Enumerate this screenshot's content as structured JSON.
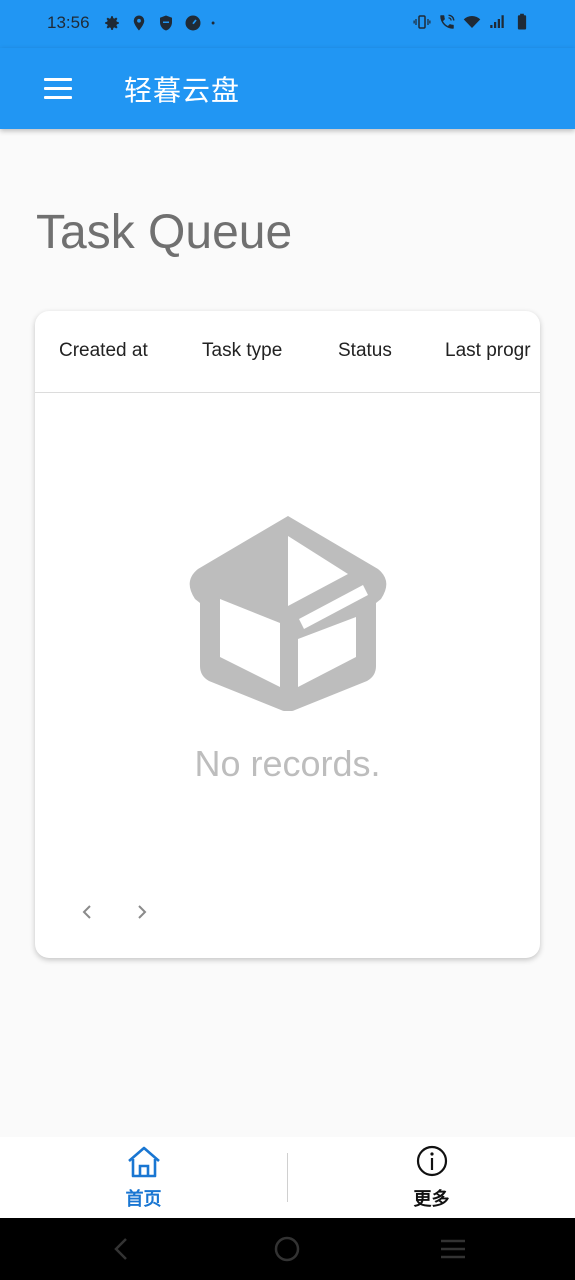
{
  "status_bar": {
    "time": "13:56",
    "left_icons": [
      "settings-icon",
      "location-icon",
      "shield-icon",
      "speed-icon",
      "dot-icon"
    ],
    "right_icons": [
      "vibrate-icon",
      "wifi-call-icon",
      "wifi-icon",
      "signal-icon",
      "battery-icon"
    ]
  },
  "app_bar": {
    "title": "轻暮云盘",
    "background": "#2196f3"
  },
  "page": {
    "title": "Task Queue"
  },
  "table": {
    "columns": [
      "Created at",
      "Task type",
      "Status",
      "Last progr"
    ],
    "empty_text": "No records.",
    "rows": []
  },
  "pagination": {
    "prev_icon": "chevron-left-icon",
    "next_icon": "chevron-right-icon"
  },
  "bottom_nav": {
    "items": [
      {
        "label": "首页",
        "icon": "home-icon",
        "active": true
      },
      {
        "label": "更多",
        "icon": "info-icon",
        "active": false
      }
    ],
    "active_color": "#1976d2"
  }
}
